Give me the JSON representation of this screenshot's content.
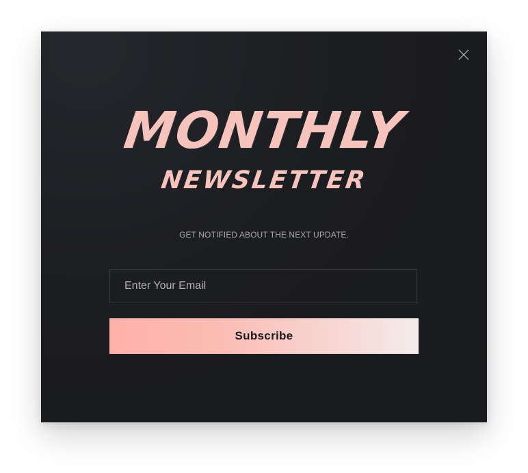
{
  "popup": {
    "title_main": "Monthly",
    "title_sub": "Newsletter",
    "tagline": "GET NOTIFIED ABOUT THE NEXT UPDATE.",
    "email_placeholder": "Enter Your Email",
    "email_value": "",
    "subscribe_label": "Subscribe"
  },
  "icons": {
    "close": "close-icon"
  },
  "colors": {
    "background": "#1c1d21",
    "title": "#f6c3bd",
    "button_gradient_start": "#ffb1a9",
    "button_gradient_end": "#f3ecec"
  }
}
